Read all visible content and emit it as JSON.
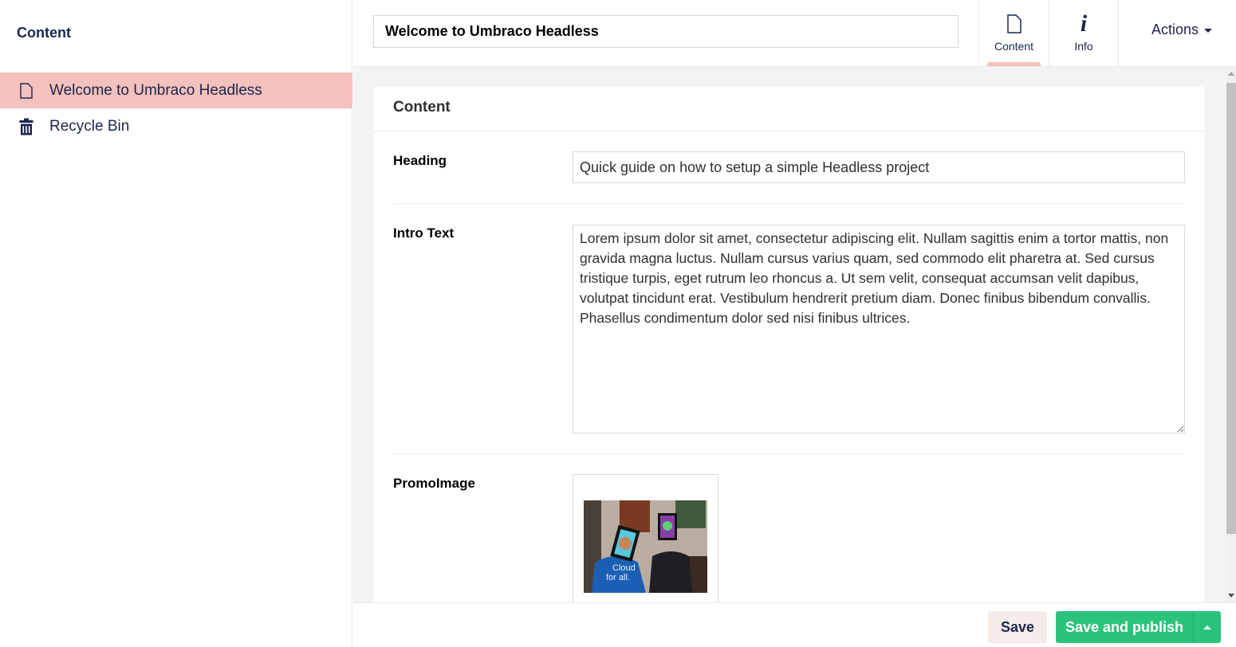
{
  "sidebar": {
    "title": "Content",
    "items": [
      {
        "label": "Welcome to Umbraco Headless",
        "icon": "document-icon",
        "active": true
      },
      {
        "label": "Recycle Bin",
        "icon": "trash-icon",
        "active": false
      }
    ]
  },
  "header": {
    "name_value": "Welcome to Umbraco Headless",
    "apps": [
      {
        "label": "Content",
        "icon": "document-icon",
        "active": true
      },
      {
        "label": "Info",
        "icon": "info-icon",
        "active": false
      }
    ],
    "actions_label": "Actions"
  },
  "main": {
    "group_title": "Content",
    "properties": {
      "heading": {
        "label": "Heading",
        "value": "Quick guide on how to setup a simple Headless project"
      },
      "intro_text": {
        "label": "Intro Text",
        "value": "Lorem ipsum dolor sit amet, consectetur adipiscing elit. Nullam sagittis enim a tortor mattis, non gravida magna luctus. Nullam cursus varius quam, sed commodo elit pharetra at. Sed cursus tristique turpis, eget rutrum leo rhoncus a. Ut sem velit, consequat accumsan velit dapibus, volutpat tincidunt erat. Vestibulum hendrerit pretium diam. Donec finibus bibendum convallis. Phasellus condimentum dolor sed nisi finibus ultrices."
      },
      "promo_image": {
        "label": "PromoImage",
        "thumbnail_caption": "Cloud for all."
      }
    }
  },
  "footer": {
    "save_label": "Save",
    "publish_label": "Save and publish"
  },
  "colors": {
    "selection": "#f5c1bc",
    "primary_text": "#1b264f",
    "publish_green": "#2bc37c",
    "save_bg": "#f3ece8"
  }
}
